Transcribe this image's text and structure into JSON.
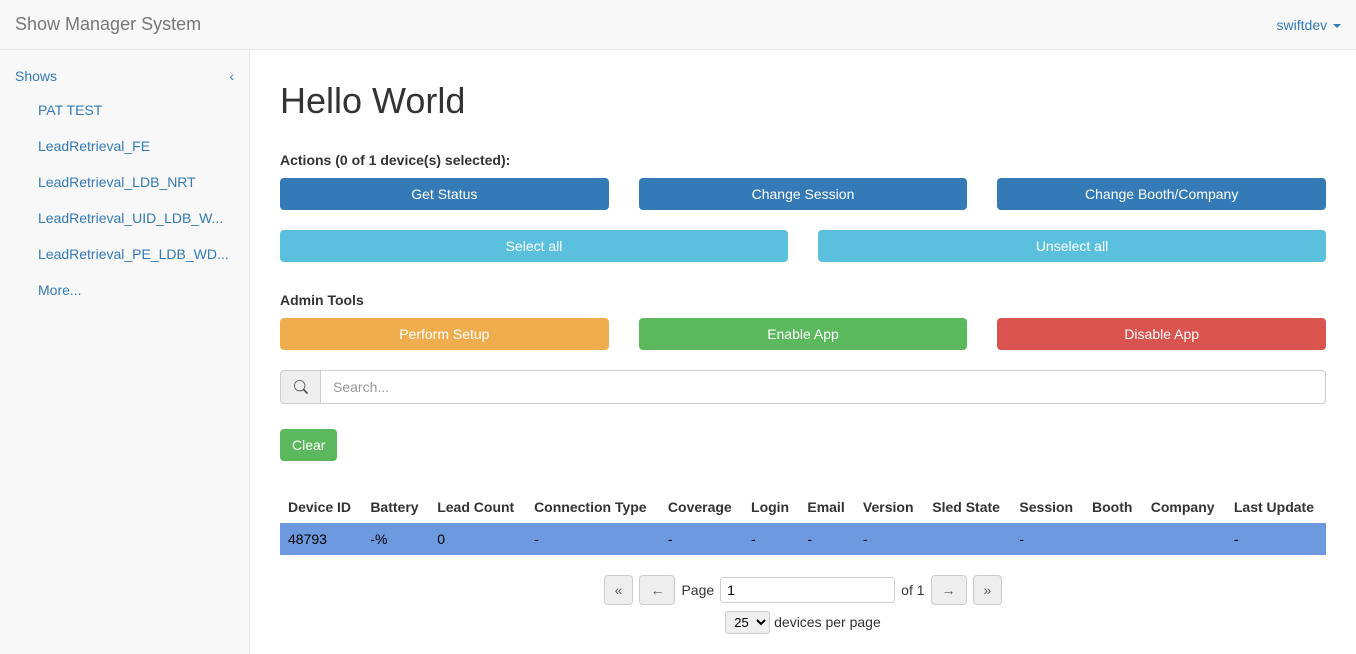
{
  "navbar": {
    "brand": "Show Manager System",
    "user": "swiftdev"
  },
  "sidebar": {
    "header": "Shows",
    "items": [
      "PAT TEST",
      "LeadRetrieval_FE",
      "LeadRetrieval_LDB_NRT",
      "LeadRetrieval_UID_LDB_W...",
      "LeadRetrieval_PE_LDB_WD..."
    ],
    "more": "More..."
  },
  "page": {
    "title": "Hello World",
    "actions_label": "Actions (0 of 1 device(s) selected):",
    "admin_label": "Admin Tools"
  },
  "buttons": {
    "get_status": "Get Status",
    "change_session": "Change Session",
    "change_booth": "Change Booth/Company",
    "select_all": "Select all",
    "unselect_all": "Unselect all",
    "perform_setup": "Perform Setup",
    "enable_app": "Enable App",
    "disable_app": "Disable App",
    "clear": "Clear"
  },
  "search": {
    "placeholder": "Search..."
  },
  "table": {
    "headers": [
      "Device ID",
      "Battery",
      "Lead Count",
      "Connection Type",
      "Coverage",
      "Login",
      "Email",
      "Version",
      "Sled State",
      "Session",
      "Booth",
      "Company",
      "Last Update"
    ],
    "rows": [
      {
        "device_id": "48793",
        "battery": "-%",
        "lead_count": "0",
        "connection_type": "-",
        "coverage": "-",
        "login": "-",
        "email": "-",
        "version": "-",
        "sled_state": "",
        "session": "-",
        "booth": "",
        "company": "",
        "last_update": "-"
      }
    ]
  },
  "pagination": {
    "page_label": "Page",
    "current": "1",
    "of_label": "of 1",
    "per_page_value": "25",
    "per_page_label": "devices per page"
  }
}
